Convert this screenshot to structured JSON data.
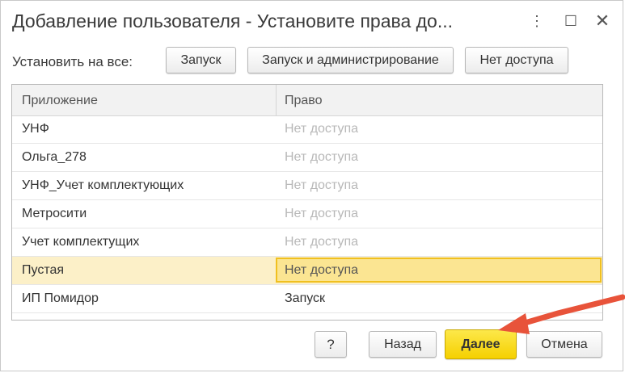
{
  "window": {
    "title": "Добавление пользователя - Установите права до...",
    "controls": {
      "more": "⋮",
      "maximize": "☐",
      "close": "✕"
    }
  },
  "set_all": {
    "label": "Установить на все:",
    "buttons": [
      "Запуск",
      "Запуск и администрирование",
      "Нет доступа"
    ]
  },
  "table": {
    "columns": [
      "Приложение",
      "Право"
    ],
    "rows": [
      {
        "app": "УНФ",
        "right": "Нет доступа"
      },
      {
        "app": "Ольга_278",
        "right": "Нет доступа"
      },
      {
        "app": "УНФ_Учет комплектующих",
        "right": "Нет доступа"
      },
      {
        "app": "Метросити",
        "right": "Нет доступа"
      },
      {
        "app": "Учет комплектущих",
        "right": "Нет доступа"
      },
      {
        "app": "Пустая",
        "right": "Нет доступа"
      },
      {
        "app": "ИП Помидор",
        "right": "Запуск"
      }
    ]
  },
  "footer": {
    "help": "?",
    "back": "Назад",
    "next": "Далее",
    "cancel": "Отмена"
  },
  "colors": {
    "accent_yellow": "#f5d000",
    "selected_row": "#fcf0c8",
    "arrow": "#e8533a"
  }
}
